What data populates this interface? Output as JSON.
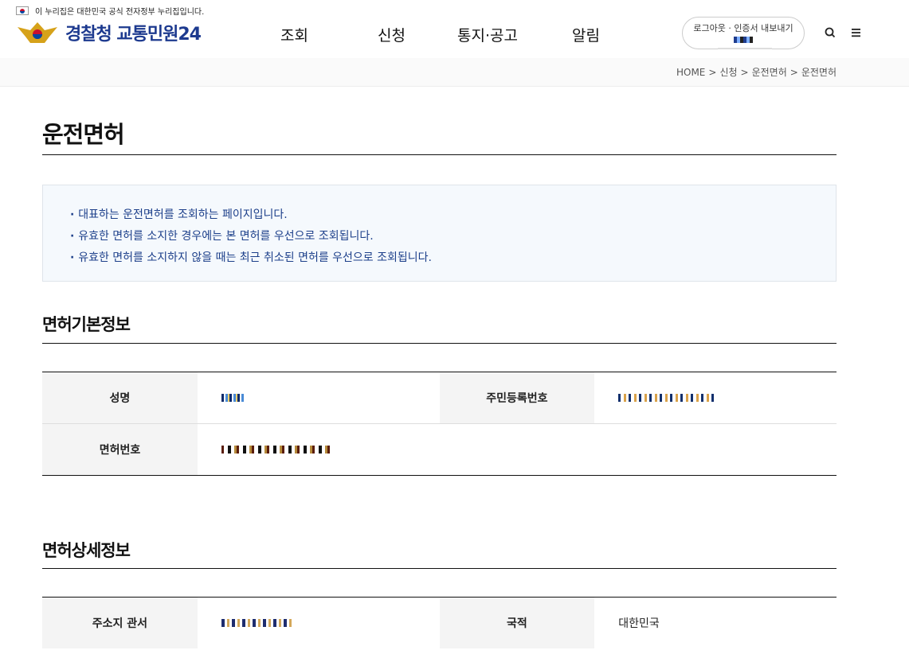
{
  "gov_banner": {
    "text": "이 누리집은 대한민국 공식 전자정부 누리집입니다."
  },
  "logo": {
    "text": "경찰청 교통민원24"
  },
  "nav": [
    {
      "label": "조회"
    },
    {
      "label": "신청"
    },
    {
      "label": "통지·공고"
    },
    {
      "label": "알림"
    }
  ],
  "login": {
    "label": "로그아웃 · 인증서 내보내기"
  },
  "icons": {
    "search": "search-icon",
    "menu": "menu-icon"
  },
  "breadcrumb": [
    "HOME",
    "신청",
    "운전면허",
    "운전면허"
  ],
  "page_title": "운전면허",
  "notice": [
    "대표하는 운전면허를 조회하는 페이지입니다.",
    "유효한 면허를 소지한 경우에는 본 면허를 우선으로 조회됩니다.",
    "유효한 면허를 소지하지 않을 때는 최근 취소된 면허를 우선으로 조회됩니다."
  ],
  "basic": {
    "title": "면허기본정보",
    "name_label": "성명",
    "rrn_label": "주민등록번호",
    "license_no_label": "면허번호"
  },
  "detail": {
    "title": "면허상세정보",
    "jurisdiction_label": "주소지 관서",
    "nationality_label": "국적",
    "nationality_value": "대한민국"
  },
  "colors": {
    "brand": "#1d3a8f",
    "notice_text": "#1c3f8a",
    "notice_bg": "#f5f9fd"
  }
}
